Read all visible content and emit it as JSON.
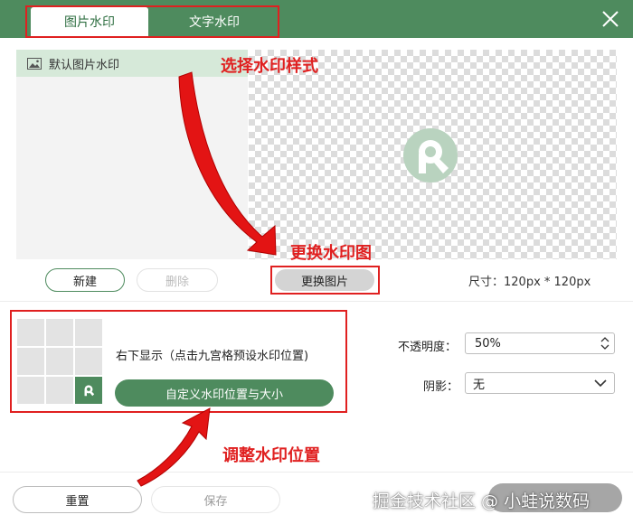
{
  "tabs": [
    {
      "label": "图片水印",
      "active": true
    },
    {
      "label": "文字水印",
      "active": false
    }
  ],
  "list": {
    "items": [
      {
        "label": "默认图片水印",
        "icon": "image-icon"
      }
    ]
  },
  "left_buttons": {
    "new": "新建",
    "delete": "删除"
  },
  "preview": {
    "change_button": "更换图片",
    "size_text": "尺寸：120px * 120px"
  },
  "position": {
    "selected_cell": 8,
    "text": "右下显示（点击九宫格预设水印位置)",
    "custom_button": "自定义水印位置与大小"
  },
  "settings": {
    "opacity_label": "不透明度：",
    "opacity_value": "50%",
    "shadow_label": "阴影：",
    "shadow_value": "无"
  },
  "footer": {
    "reset": "重置",
    "save": "保存"
  },
  "annotations": {
    "select_style": "选择水印样式",
    "change_image": "更换水印图",
    "adjust_position": "调整水印位置"
  },
  "watermark": "掘金技术社区 @ 小蛙说数码",
  "colors": {
    "accent": "#4e8b5e",
    "annotation": "#e02020"
  }
}
